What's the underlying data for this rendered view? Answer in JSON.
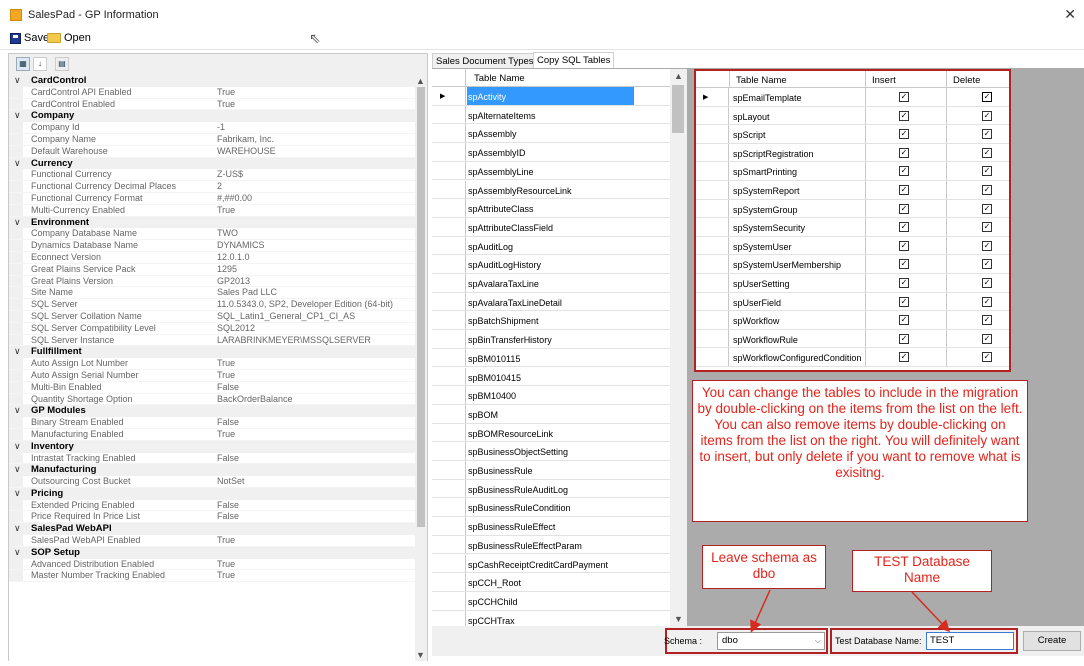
{
  "window": {
    "title": "SalesPad - GP Information",
    "close_glyph": "✕"
  },
  "toolbar": {
    "save_label": "Save",
    "open_label": "Open"
  },
  "property_grid": {
    "categories": [
      {
        "name": "CardControl",
        "rows": [
          [
            "CardControl API Enabled",
            "True"
          ],
          [
            "CardControl Enabled",
            "True"
          ]
        ]
      },
      {
        "name": "Company",
        "rows": [
          [
            "Company Id",
            "-1"
          ],
          [
            "Company Name",
            "Fabrikam, Inc."
          ],
          [
            "Default Warehouse",
            "WAREHOUSE"
          ]
        ]
      },
      {
        "name": "Currency",
        "rows": [
          [
            "Functional Currency",
            "Z-US$"
          ],
          [
            "Functional Currency Decimal Places",
            "2"
          ],
          [
            "Functional Currency Format",
            "#,##0.00"
          ],
          [
            "Multi-Currency Enabled",
            "True"
          ]
        ]
      },
      {
        "name": "Environment",
        "rows": [
          [
            "Company Database Name",
            "TWO"
          ],
          [
            "Dynamics Database Name",
            "DYNAMICS"
          ],
          [
            "Econnect Version",
            "12.0.1.0"
          ],
          [
            "Great Plains Service Pack",
            "1295"
          ],
          [
            "Great Plains Version",
            "GP2013"
          ],
          [
            "Site Name",
            "Sales Pad LLC"
          ],
          [
            "SQL Server",
            "11.0.5343.0, SP2, Developer Edition (64-bit)"
          ],
          [
            "SQL Server Collation Name",
            "SQL_Latin1_General_CP1_CI_AS"
          ],
          [
            "SQL Server Compatibility Level",
            "SQL2012"
          ],
          [
            "SQL Server Instance",
            "LARABRINKMEYER\\MSSQLSERVER"
          ]
        ]
      },
      {
        "name": "Fullfillment",
        "rows": [
          [
            "Auto Assign Lot Number",
            "True"
          ],
          [
            "Auto Assign Serial Number",
            "True"
          ],
          [
            "Multi-Bin Enabled",
            "False"
          ],
          [
            "Quantity Shortage Option",
            "BackOrderBalance"
          ]
        ]
      },
      {
        "name": "GP Modules",
        "rows": [
          [
            "Binary Stream Enabled",
            "False"
          ],
          [
            "Manufacturing Enabled",
            "True"
          ]
        ]
      },
      {
        "name": "Inventory",
        "rows": [
          [
            "Intrastat Tracking Enabled",
            "False"
          ]
        ]
      },
      {
        "name": "Manufacturing",
        "rows": [
          [
            "Outsourcing Cost Bucket",
            "NotSet"
          ]
        ]
      },
      {
        "name": "Pricing",
        "rows": [
          [
            "Extended Pricing Enabled",
            "False"
          ],
          [
            "Price Required In Price List",
            "False"
          ]
        ]
      },
      {
        "name": "SalesPad WebAPI",
        "rows": [
          [
            "SalesPad WebAPI Enabled",
            "True"
          ]
        ]
      },
      {
        "name": "SOP Setup",
        "rows": [
          [
            "Advanced Distribution Enabled",
            "True"
          ],
          [
            "Master Number Tracking Enabled",
            "True"
          ]
        ]
      }
    ]
  },
  "tabs": [
    {
      "label": "Sales Document Types"
    },
    {
      "label": "Copy SQL Tables"
    }
  ],
  "left_table": {
    "header": "Table Name",
    "rows": [
      "spActivity",
      "spAlternateItems",
      "spAssembly",
      "spAssemblyID",
      "spAssemblyLine",
      "spAssemblyResourceLink",
      "spAttributeClass",
      "spAttributeClassField",
      "spAuditLog",
      "spAuditLogHistory",
      "spAvalaraTaxLine",
      "spAvalaraTaxLineDetail",
      "spBatchShipment",
      "spBinTransferHistory",
      "spBM010115",
      "spBM010415",
      "spBM10400",
      "spBOM",
      "spBOMResourceLink",
      "spBusinessObjectSetting",
      "spBusinessRule",
      "spBusinessRuleAuditLog",
      "spBusinessRuleCondition",
      "spBusinessRuleEffect",
      "spBusinessRuleEffectParam",
      "spCashReceiptCreditCardPayment",
      "spCCH_Root",
      "spCCHChild",
      "spCCHTrax"
    ]
  },
  "right_table": {
    "headers": {
      "name": "Table Name",
      "insert": "Insert",
      "delete": "Delete"
    },
    "rows": [
      "spEmailTemplate",
      "spLayout",
      "spScript",
      "spScriptRegistration",
      "spSmartPrinting",
      "spSystemReport",
      "spSystemGroup",
      "spSystemSecurity",
      "spSystemUser",
      "spSystemUserMembership",
      "spUserSetting",
      "spUserField",
      "spWorkflow",
      "spWorkflowRule",
      "spWorkflowConfiguredCondition"
    ],
    "check_glyph": "✓"
  },
  "callouts": {
    "main": "You can change the tables to include in the migration by double-clicking on the items from the list on the left.  You can also remove items by double-clicking on items from the list on the right.  You will definitely want to insert, but only delete if you want to remove what is exisitng.",
    "schema": "Leave schema as dbo",
    "test": "TEST Database Name"
  },
  "bottom": {
    "schema_label": "Schema :",
    "schema_value": "dbo",
    "testdb_label": "Test Database Name:",
    "testdb_value": "TEST",
    "create_label": "Create"
  },
  "colors": {
    "accent_red": "#b22222",
    "callout_text": "#e3241b",
    "selection": "#3399ff"
  }
}
